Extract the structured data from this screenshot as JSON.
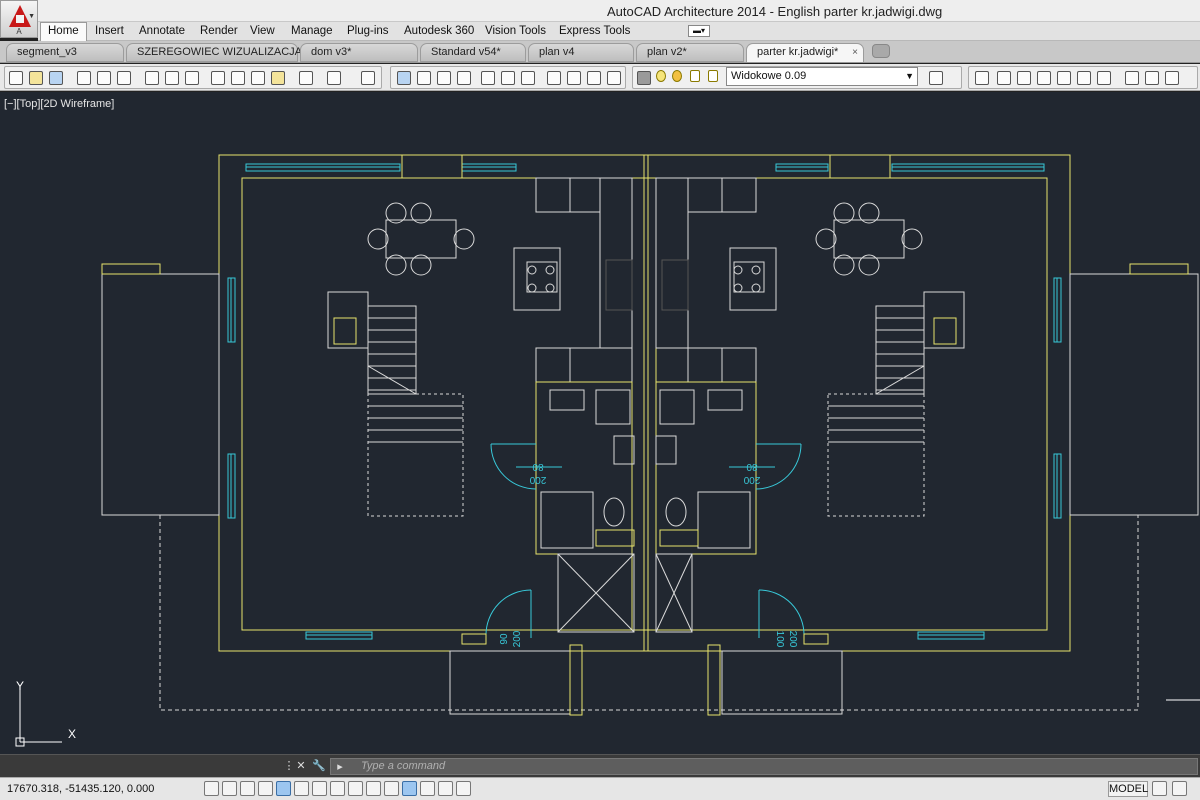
{
  "app": {
    "logo_label": "A",
    "title": "AutoCAD Architecture 2014 - English    parter kr.jadwigi.dwg"
  },
  "ribbon": {
    "tabs": [
      "Home",
      "Insert",
      "Annotate",
      "Render",
      "View",
      "Manage",
      "Plug-ins",
      "Autodesk 360",
      "Vision Tools",
      "Express Tools"
    ],
    "active_tab": "Home"
  },
  "file_tabs": {
    "tabs": [
      "segment_v3",
      "SZEREGOWIEC WIZUALIZACJA*",
      "dom v3*",
      "Standard v54*",
      "plan v4",
      "plan v2*",
      "parter kr.jadwigi*"
    ],
    "active_index": 6,
    "close_glyph": "×"
  },
  "toolbar": {
    "layer_name": "Widokowe 0.09",
    "icons": [
      "new-icon",
      "open-icon",
      "save-icon",
      "print-icon",
      "plot-preview-icon",
      "publish-icon",
      "spell-check-icon",
      "match-properties-icon",
      "calculator-icon",
      "cut-icon",
      "copy-icon",
      "paste-icon",
      "undo-icon",
      "redo-icon",
      "pan-icon",
      "help-icon",
      "layer-icon",
      "zoom-icon",
      "layer-state-icon",
      "view-cube-icon"
    ]
  },
  "viewport": {
    "label": "[−][Top][2D Wireframe]",
    "axis_y": "Y",
    "axis_x": "X",
    "dimensions": {
      "left_bath_door": [
        "80",
        "200"
      ],
      "right_bath_door": [
        "80",
        "200"
      ],
      "left_entry_door": [
        "90",
        "200"
      ],
      "right_entry_door": [
        "100",
        "200"
      ]
    }
  },
  "command": {
    "placeholder": "Type a command"
  },
  "status": {
    "coordinates": "17670.318, -51435.120, 0.000",
    "model_button": "MODEL"
  },
  "colors": {
    "viewport_bg": "#212730",
    "wall": "#e6e36b",
    "line": "#d9d9d9",
    "window": "#38c8d8",
    "door_arc": "#38c8d8"
  }
}
